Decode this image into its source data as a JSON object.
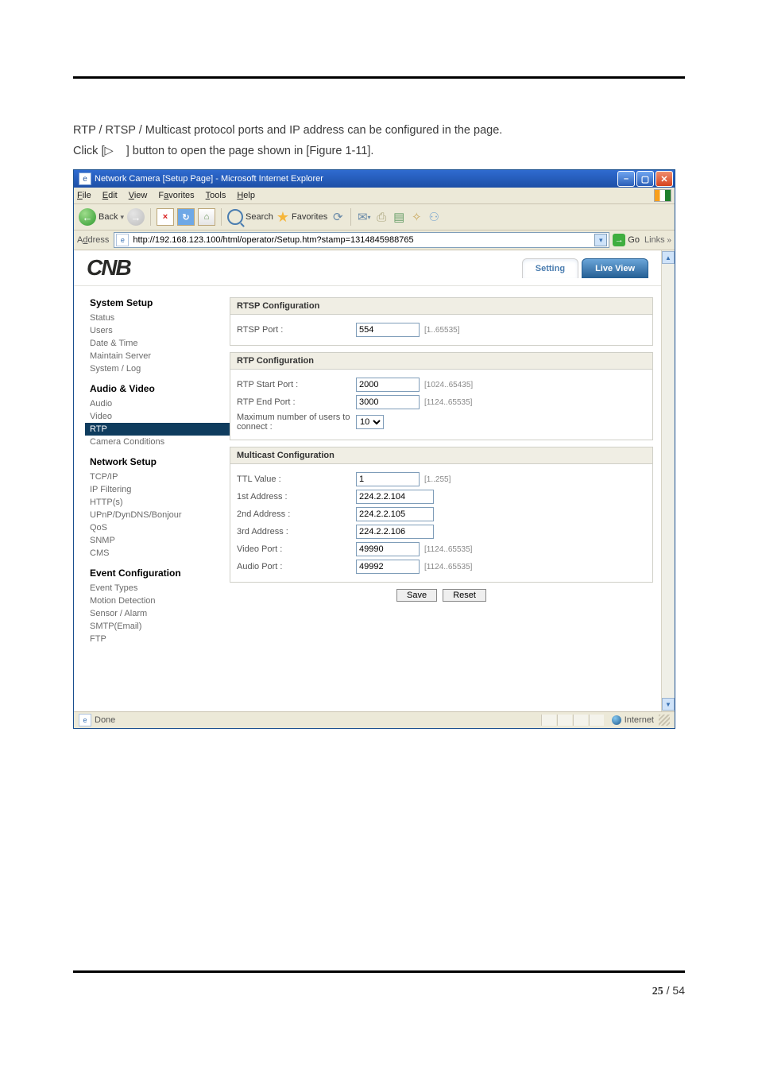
{
  "intro": {
    "line1": "RTP / RTSP / Multicast protocol ports and IP address can be configured in the page.",
    "line2_a": "Click [",
    "line2_b": "] button to open the page shown in [Figure 1-11]."
  },
  "window": {
    "title": "Network Camera [Setup Page] - Microsoft Internet Explorer",
    "menus": {
      "file": "File",
      "edit": "Edit",
      "view": "View",
      "favorites": "Favorites",
      "tools": "Tools",
      "help": "Help"
    },
    "toolbar": {
      "back": "Back",
      "search": "Search",
      "favorites": "Favorites"
    },
    "address_label": "Address",
    "url": "http://192.168.123.100/html/operator/Setup.htm?stamp=1314845988765",
    "go": "Go",
    "links": "Links",
    "status_done": "Done",
    "status_zone": "Internet"
  },
  "header": {
    "logo": "CNB",
    "tab_setting": "Setting",
    "tab_live": "Live View"
  },
  "nav": {
    "system_setup": "System Setup",
    "system": {
      "status": "Status",
      "users": "Users",
      "datetime": "Date & Time",
      "maintain": "Maintain Server",
      "syslog": "System / Log"
    },
    "av": "Audio & Video",
    "av_items": {
      "audio": "Audio",
      "video": "Video",
      "rtp": "RTP",
      "camera": "Camera Conditions"
    },
    "net": "Network Setup",
    "net_items": {
      "tcpip": "TCP/IP",
      "ipf": "IP Filtering",
      "http": "HTTP(s)",
      "upnp": "UPnP/DynDNS/Bonjour",
      "qos": "QoS",
      "snmp": "SNMP",
      "cms": "CMS"
    },
    "event": "Event Configuration",
    "event_items": {
      "types": "Event Types",
      "motion": "Motion Detection",
      "sensor": "Sensor / Alarm",
      "smtp": "SMTP(Email)",
      "ftp": "FTP"
    }
  },
  "cfg": {
    "rtsp": {
      "title": "RTSP Configuration",
      "port_label": "RTSP Port :",
      "port_value": "554",
      "port_hint": "[1..65535]"
    },
    "rtp": {
      "title": "RTP Configuration",
      "start_label": "RTP Start Port :",
      "start_value": "2000",
      "start_hint": "[1024..65435]",
      "end_label": "RTP End Port :",
      "end_value": "3000",
      "end_hint": "[1124..65535]",
      "max_label": "Maximum number of users to connect :",
      "max_value": "10"
    },
    "mc": {
      "title": "Multicast Configuration",
      "ttl_label": "TTL Value :",
      "ttl_value": "1",
      "ttl_hint": "[1..255]",
      "a1_label": "1st Address :",
      "a1_value": "224.2.2.104",
      "a2_label": "2nd Address :",
      "a2_value": "224.2.2.105",
      "a3_label": "3rd Address :",
      "a3_value": "224.2.2.106",
      "vp_label": "Video Port :",
      "vp_value": "49990",
      "vp_hint": "[1124..65535]",
      "ap_label": "Audio Port :",
      "ap_value": "49992",
      "ap_hint": "[1124..65535]"
    },
    "save": "Save",
    "reset": "Reset"
  },
  "footer": {
    "page": "25",
    "sep": " / ",
    "total": "54"
  }
}
